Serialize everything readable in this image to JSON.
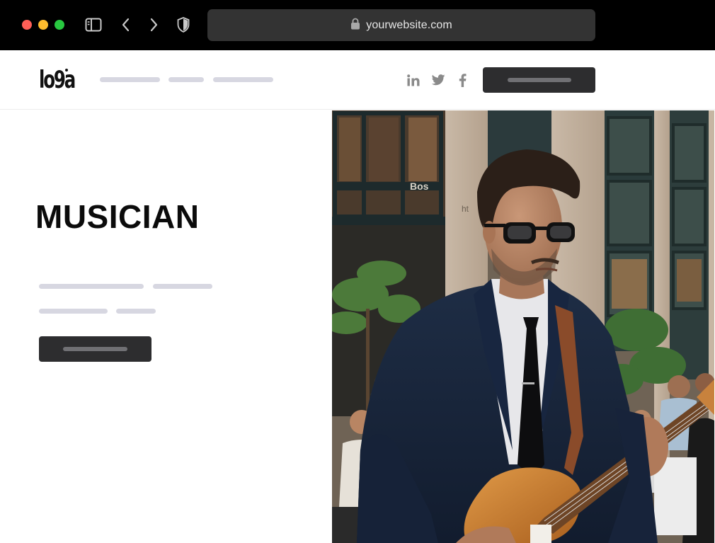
{
  "browser": {
    "url": "yourwebsite.com",
    "icons": [
      "sidebar-icon",
      "back-arrow-icon",
      "forward-arrow-icon",
      "shield-icon",
      "lock-icon"
    ]
  },
  "header": {
    "logo_text": "lo9a",
    "social_icons": [
      "linkedin-icon",
      "twitter-icon",
      "facebook-icon"
    ]
  },
  "hero": {
    "title": "MUSICIAN"
  },
  "colors": {
    "placeholder": "#d7d7e1",
    "button": "#2d2d2f",
    "text": "#0b0b0b"
  }
}
